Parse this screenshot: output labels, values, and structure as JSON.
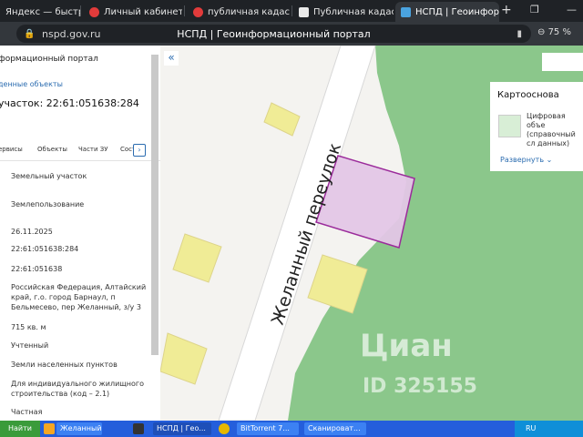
{
  "browser": {
    "tabs": [
      {
        "label": "Яндекс — быстрый п",
        "icon": "yandex-icon"
      },
      {
        "label": "Личный кабинет - О",
        "icon": "cabinet-icon"
      },
      {
        "label": "публичная кадастро",
        "icon": "yandex-search-icon"
      },
      {
        "label": "Публичная кадастро",
        "icon": "map-icon"
      },
      {
        "label": "НСПД | Геоинфор",
        "icon": "nspd-icon"
      }
    ],
    "url_domain": "nspd.gov.ru",
    "page_title": "НСПД | Геоинформационный портал",
    "zoom": "75 %"
  },
  "left_panel": {
    "title": "формационный портал",
    "found_link": "денные объекты",
    "parcel_heading": "участок: 22:61:051638:284",
    "tabs": [
      "ервисы",
      "Объекты",
      "Части ЗУ",
      "Сост"
    ],
    "fields": [
      "Земельный участок",
      "Землепользование",
      "26.11.2025",
      "22:61:051638:284",
      "22:61:051638",
      "Российская Федерация, Алтайский край, г.о. город Барнаул, п Бельмесево, пер Желанный, з/у 3",
      "715 кв. м",
      "Учтенный",
      "Земли населенных пунктов",
      "Для индивидуального жилищного строительства (код – 2.1)",
      "Частная"
    ]
  },
  "map": {
    "street_label": "Желанный переулок",
    "layers_title": "Картооснова",
    "layer_name": "Цифровая объе (справочный сл данных)",
    "expand_label": "Развернуть",
    "watermark": "Циан",
    "watermark_id": "ID 325155",
    "colors": {
      "green": "#8bc78b",
      "building": "#f0ec96",
      "parcel": "#e3c6e6",
      "parcel_border": "#9b2b9b",
      "road": "#ffffff"
    }
  },
  "taskbar": {
    "start_label": "Найти",
    "items": [
      "Желанный ...",
      "НСПД | Гео...",
      "BitTorrent 7...",
      "Сканироват..."
    ],
    "lang": "RU"
  }
}
